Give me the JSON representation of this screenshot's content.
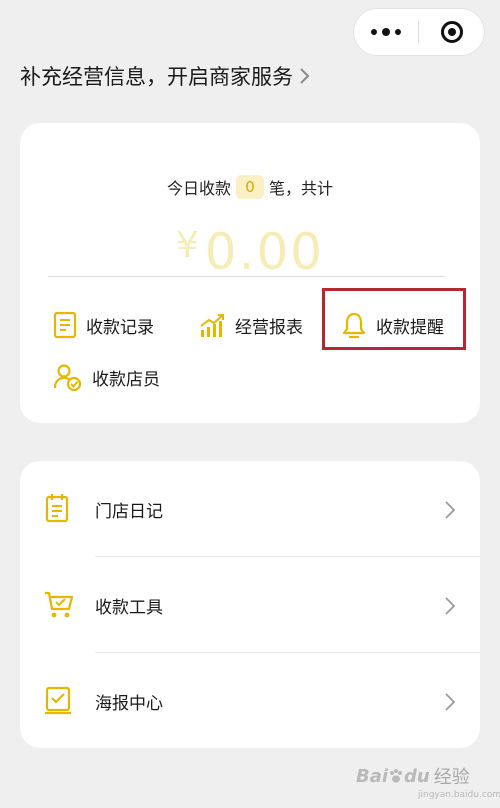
{
  "capsule": {
    "more_icon": "more-dots-icon",
    "close_icon": "close-target-icon"
  },
  "banner": {
    "text": "补充经营信息，开启商家服务",
    "icon": "chevron-right-icon"
  },
  "summary": {
    "prefix": "今日收款",
    "count": "0",
    "suffix": "笔，共计",
    "amount_symbol": "¥",
    "amount_value": "0.00"
  },
  "actions": [
    {
      "label": "收款记录",
      "icon": "document-icon"
    },
    {
      "label": "经营报表",
      "icon": "trend-chart-icon"
    },
    {
      "label": "收款提醒",
      "icon": "bell-icon"
    },
    {
      "label": "收款店员",
      "icon": "staff-icon"
    }
  ],
  "menu": [
    {
      "label": "门店日记",
      "icon": "notebook-icon"
    },
    {
      "label": "收款工具",
      "icon": "cart-icon"
    },
    {
      "label": "海报中心",
      "icon": "poster-icon"
    }
  ],
  "watermark": {
    "brand": "Bai",
    "brand_tail": "du",
    "sub": "经验",
    "url": "jingyan.baidu.com"
  },
  "colors": {
    "accent": "#e5b800",
    "amount": "#f8ecb6",
    "highlight_border": "#b5282f",
    "background": "#efefef"
  }
}
